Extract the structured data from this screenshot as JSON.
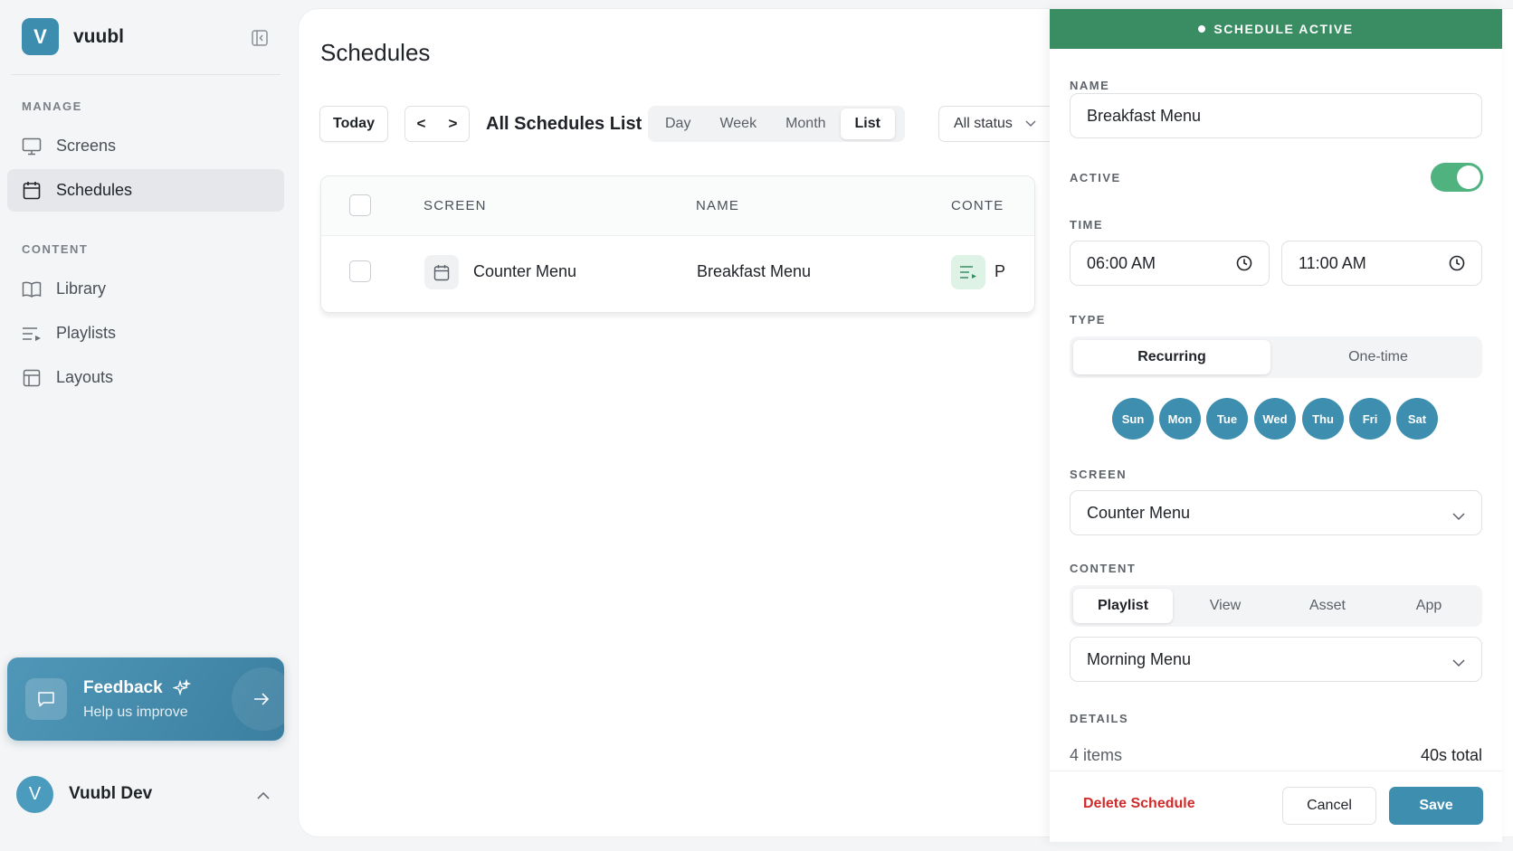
{
  "app": {
    "logo_letter": "V",
    "name": "vuubl"
  },
  "sidebar": {
    "manage_label": "MANAGE",
    "manage_items": [
      {
        "label": "Screens",
        "icon": "monitor-icon",
        "active": false
      },
      {
        "label": "Schedules",
        "icon": "calendar-icon",
        "active": true
      }
    ],
    "content_label": "CONTENT",
    "content_items": [
      {
        "label": "Library",
        "icon": "book-icon",
        "active": false
      },
      {
        "label": "Playlists",
        "icon": "playlist-icon",
        "active": false
      },
      {
        "label": "Layouts",
        "icon": "layout-icon",
        "active": false
      }
    ],
    "feedback": {
      "title": "Feedback",
      "subtitle": "Help us improve"
    },
    "user": {
      "initial": "V",
      "name": "Vuubl Dev"
    }
  },
  "main": {
    "title": "Schedules",
    "toolbar": {
      "today_label": "Today",
      "prev_label": "<",
      "next_label": ">",
      "list_title": "All Schedules List",
      "views": [
        "Day",
        "Week",
        "Month",
        "List"
      ],
      "active_view": "List",
      "status_filter": "All status"
    },
    "table": {
      "columns": [
        "SCREEN",
        "NAME",
        "CONTE"
      ],
      "rows": [
        {
          "screen": "Counter Menu",
          "name": "Breakfast Menu",
          "content_initial": "P"
        }
      ]
    }
  },
  "drawer": {
    "banner": "SCHEDULE ACTIVE",
    "name_label": "NAME",
    "name_value": "Breakfast Menu",
    "active_label": "ACTIVE",
    "active_on": true,
    "time_label": "TIME",
    "start_time": "06:00 AM",
    "end_time": "11:00 AM",
    "type_label": "TYPE",
    "type_options": [
      "Recurring",
      "One-time"
    ],
    "type_selected": "Recurring",
    "days": [
      "Sun",
      "Mon",
      "Tue",
      "Wed",
      "Thu",
      "Fri",
      "Sat"
    ],
    "screen_label": "SCREEN",
    "screen_value": "Counter Menu",
    "content_label": "CONTENT",
    "content_tabs": [
      "Playlist",
      "View",
      "Asset",
      "App"
    ],
    "content_tab_selected": "Playlist",
    "content_value": "Morning Menu",
    "details_label": "DETAILS",
    "details_items": "4 items",
    "details_total": "40s total",
    "delete_label": "Delete Schedule",
    "cancel_label": "Cancel",
    "save_label": "Save"
  },
  "colors": {
    "brand": "#3d8dae",
    "active_banner": "#3a8c62",
    "toggle_on": "#4fb27f",
    "danger": "#d12a2a"
  }
}
